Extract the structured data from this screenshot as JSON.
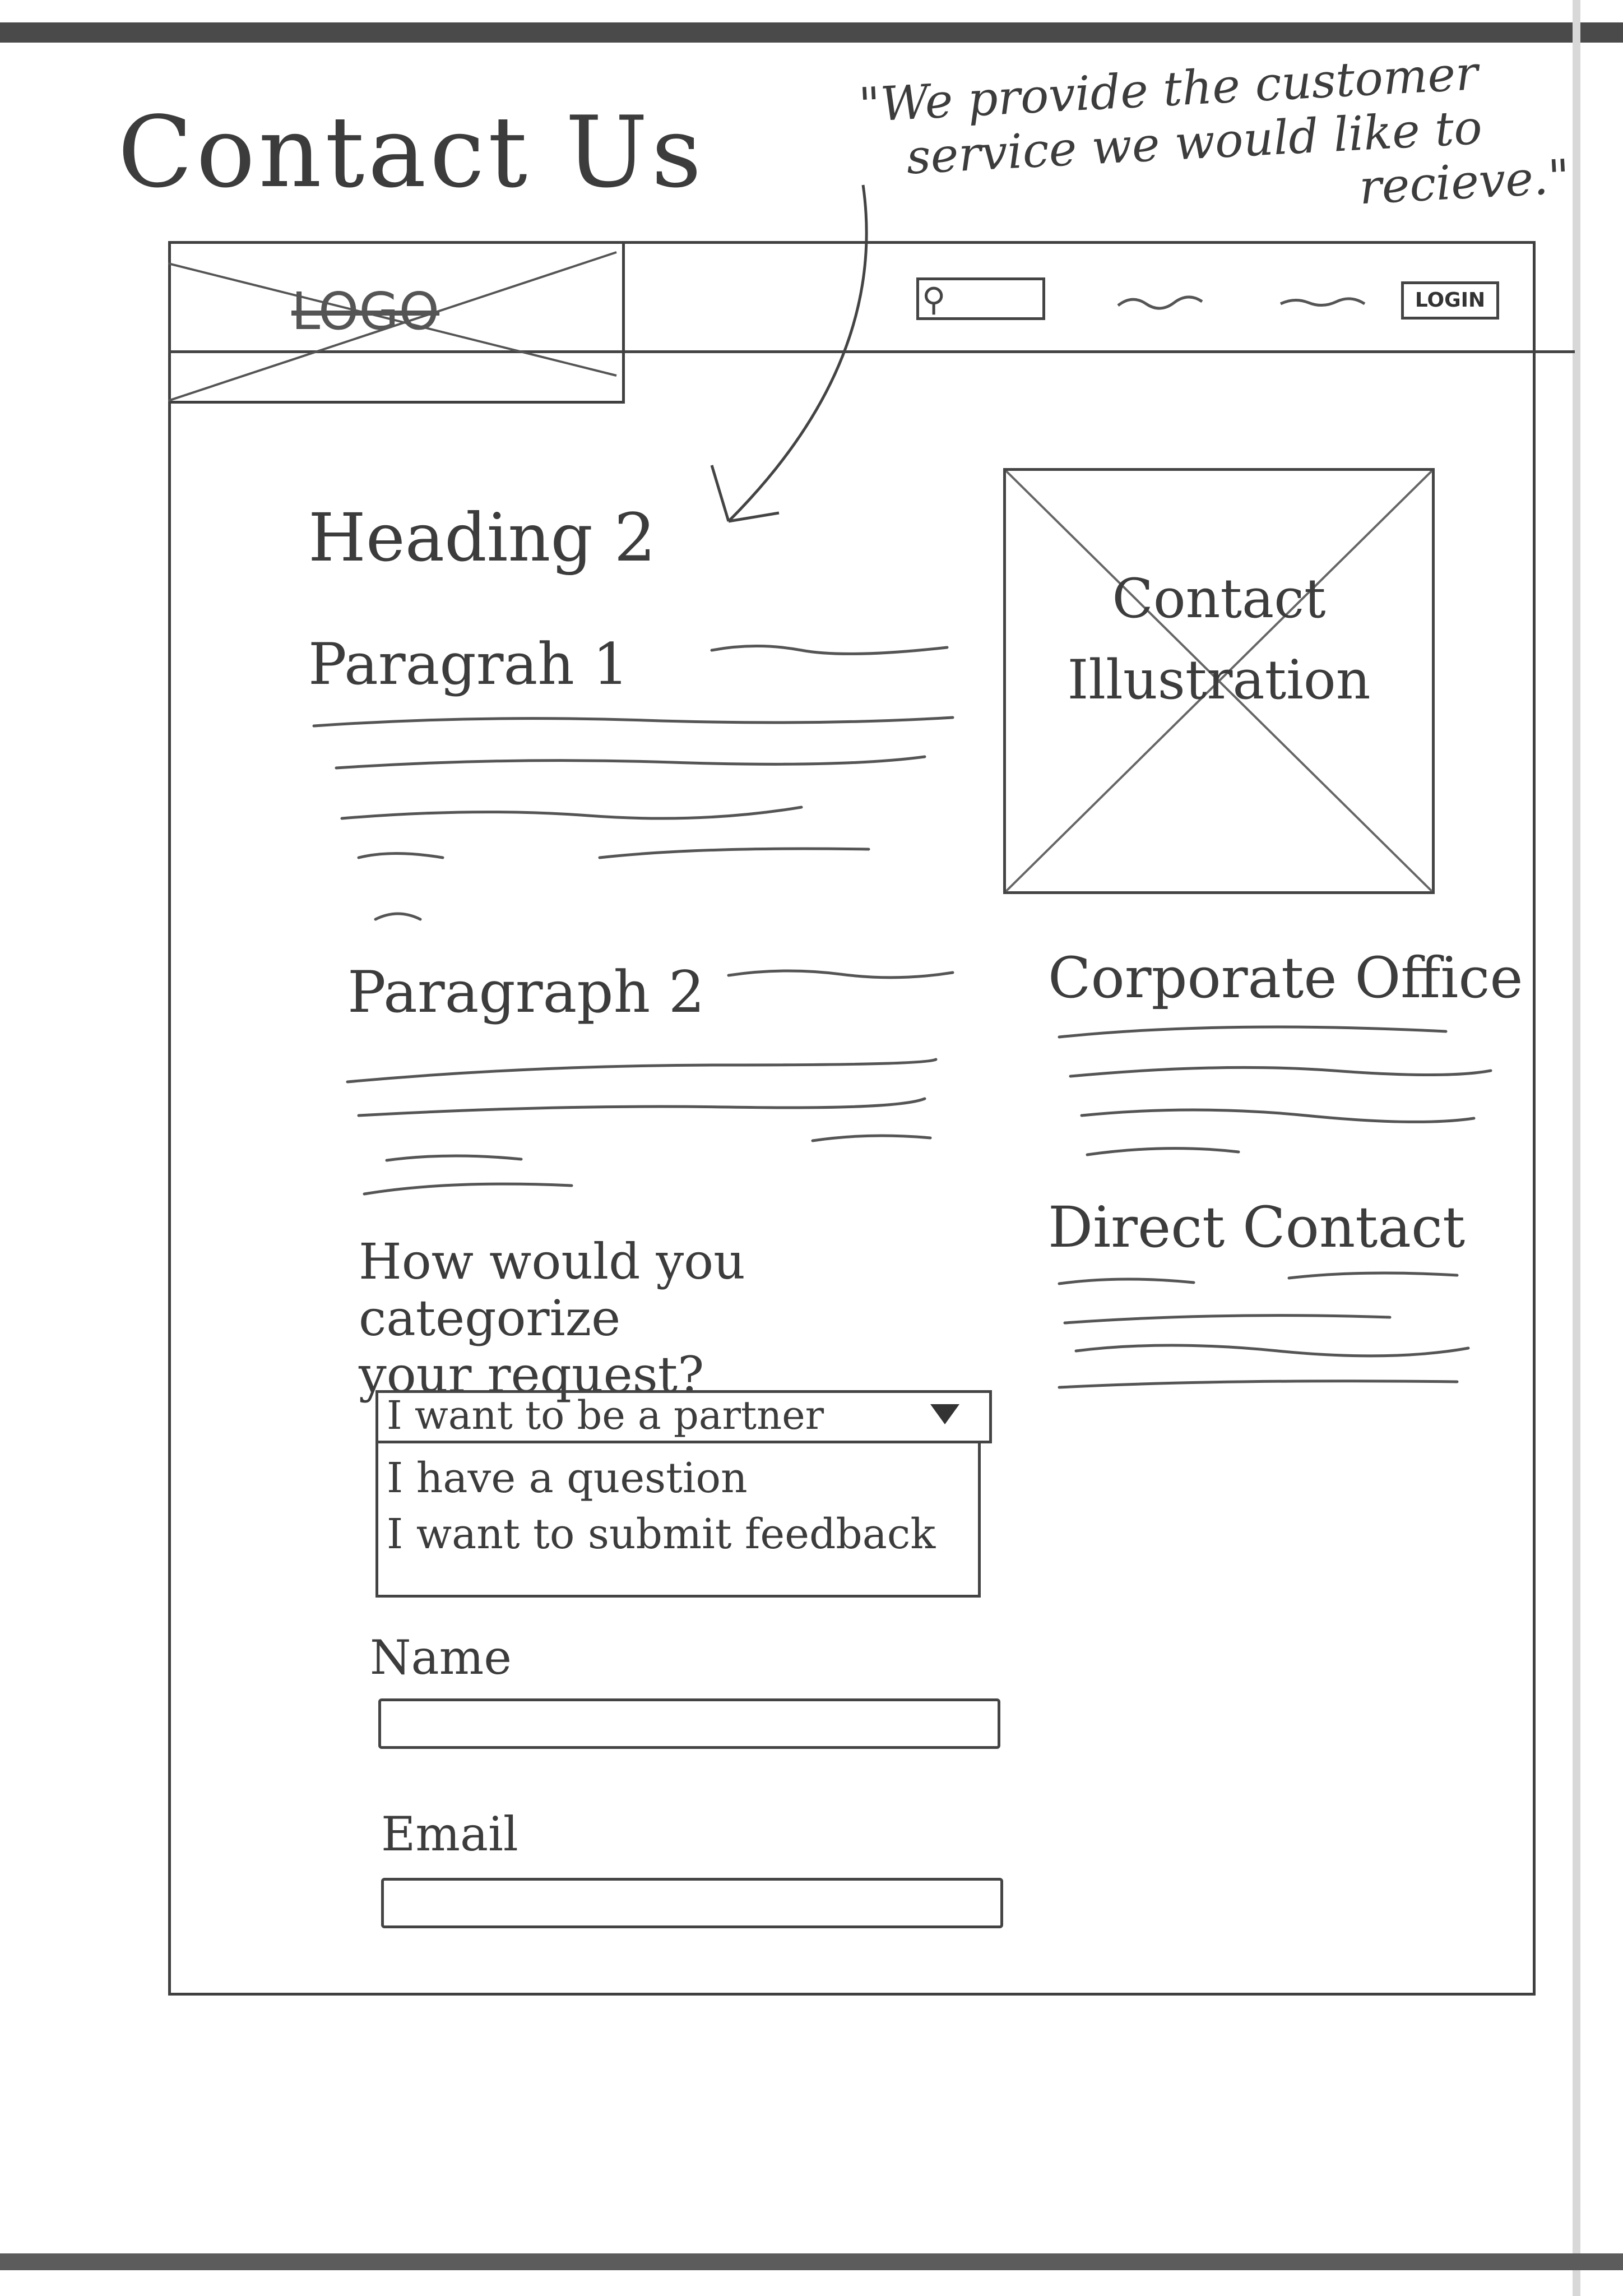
{
  "page": {
    "title": "Contact Us",
    "tagline_lines": [
      "\"We provide the customer",
      "service we would like to",
      "recieve.\""
    ]
  },
  "header": {
    "logo_text": "LOGO",
    "search_icon": "search-icon",
    "login_label": "LOGIN"
  },
  "main": {
    "heading": "Heading 2",
    "paragraph1_label": "Paragrah 1",
    "paragraph2_label": "Paragraph 2",
    "form": {
      "question_line1": "How would you categorize",
      "question_line2": "your request?",
      "select_value": "I want to be a partner",
      "options": [
        "I have a question",
        "I want to submit feedback"
      ],
      "name_label": "Name",
      "email_label": "Email"
    }
  },
  "sidebar": {
    "illustration_line1": "Contact",
    "illustration_line2": "Illustration",
    "corporate_office": "Corporate Office",
    "direct_contact": "Direct Contact"
  }
}
